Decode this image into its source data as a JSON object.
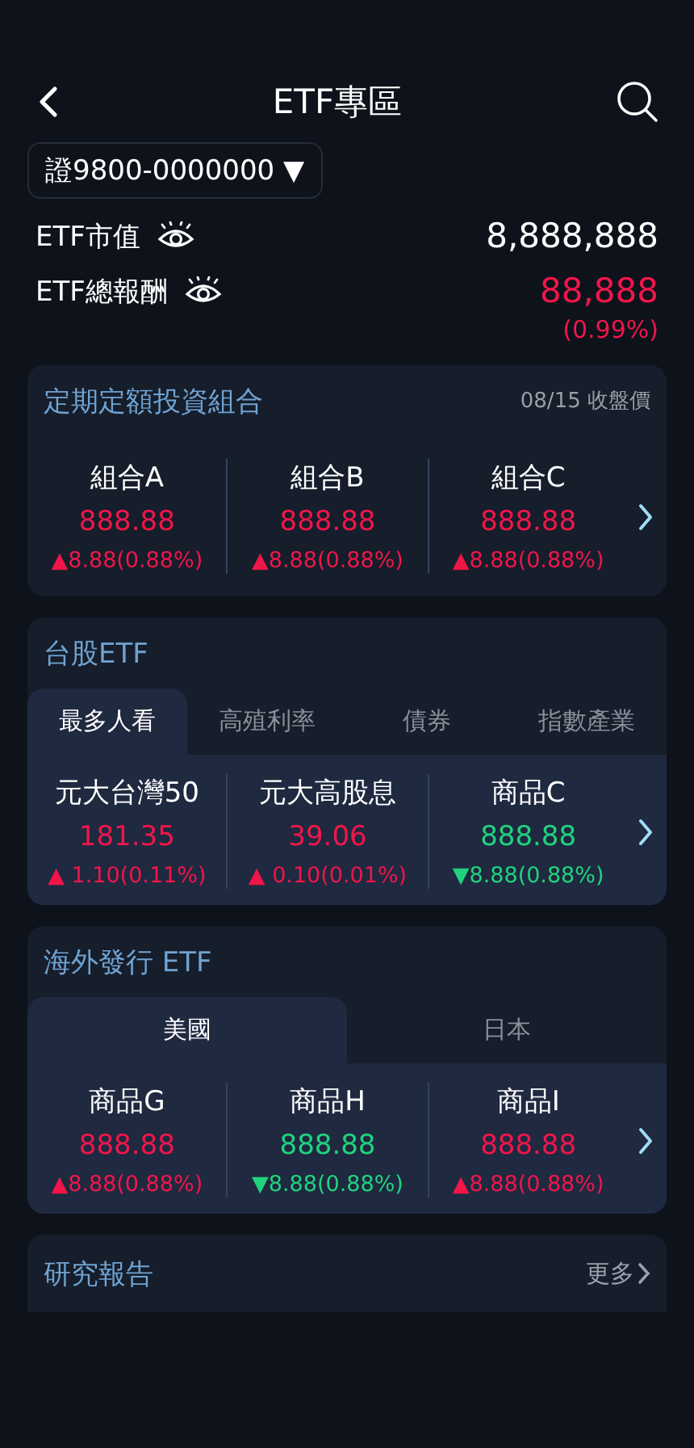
{
  "header": {
    "title": "ETF專區"
  },
  "account": {
    "value": "證9800-0000000",
    "caret": "▼"
  },
  "summary": [
    {
      "label": "ETF市值",
      "value": "8,888,888",
      "color": "#ffffff"
    },
    {
      "label": "ETF總報酬",
      "value": "88,888",
      "sub": "(0.99%)",
      "color": "#f0164a"
    }
  ],
  "sections": [
    {
      "title": "定期定額投資組合",
      "note": "08/15 收盤價",
      "items": [
        {
          "name": "組合A",
          "price": "888.88",
          "change": "▲8.88(0.88%)",
          "color": "#f0164a"
        },
        {
          "name": "組合B",
          "price": "888.88",
          "change": "▲8.88(0.88%)",
          "color": "#f0164a"
        },
        {
          "name": "組合C",
          "price": "888.88",
          "change": "▲8.88(0.88%)",
          "color": "#f0164a"
        }
      ]
    },
    {
      "title": "台股ETF",
      "tabs": [
        {
          "label": "最多人看",
          "selected": true
        },
        {
          "label": "高殖利率",
          "selected": false
        },
        {
          "label": "債券",
          "selected": false
        },
        {
          "label": "指數產業",
          "selected": false
        }
      ],
      "items": [
        {
          "name": "元大台灣50",
          "price": "181.35",
          "change": "▲ 1.10(0.11%)",
          "color": "#f0164a"
        },
        {
          "name": "元大高股息",
          "price": "39.06",
          "change": "▲ 0.10(0.01%)",
          "color": "#f0164a"
        },
        {
          "name": "商品C",
          "price": "888.88",
          "change": "▼8.88(0.88%)",
          "color": "#1fd37d"
        }
      ]
    },
    {
      "title": "海外發行 ETF",
      "tabs": [
        {
          "label": "美國",
          "selected": true
        },
        {
          "label": "日本",
          "selected": false
        }
      ],
      "items": [
        {
          "name": "商品G",
          "price": "888.88",
          "change": "▲8.88(0.88%)",
          "color": "#f0164a"
        },
        {
          "name": "商品H",
          "price": "888.88",
          "change": "▼8.88(0.88%)",
          "color": "#1fd37d"
        },
        {
          "name": "商品I",
          "price": "888.88",
          "change": "▲8.88(0.88%)",
          "color": "#f0164a"
        }
      ]
    }
  ],
  "report": {
    "title": "研究報告",
    "more": "更多"
  }
}
